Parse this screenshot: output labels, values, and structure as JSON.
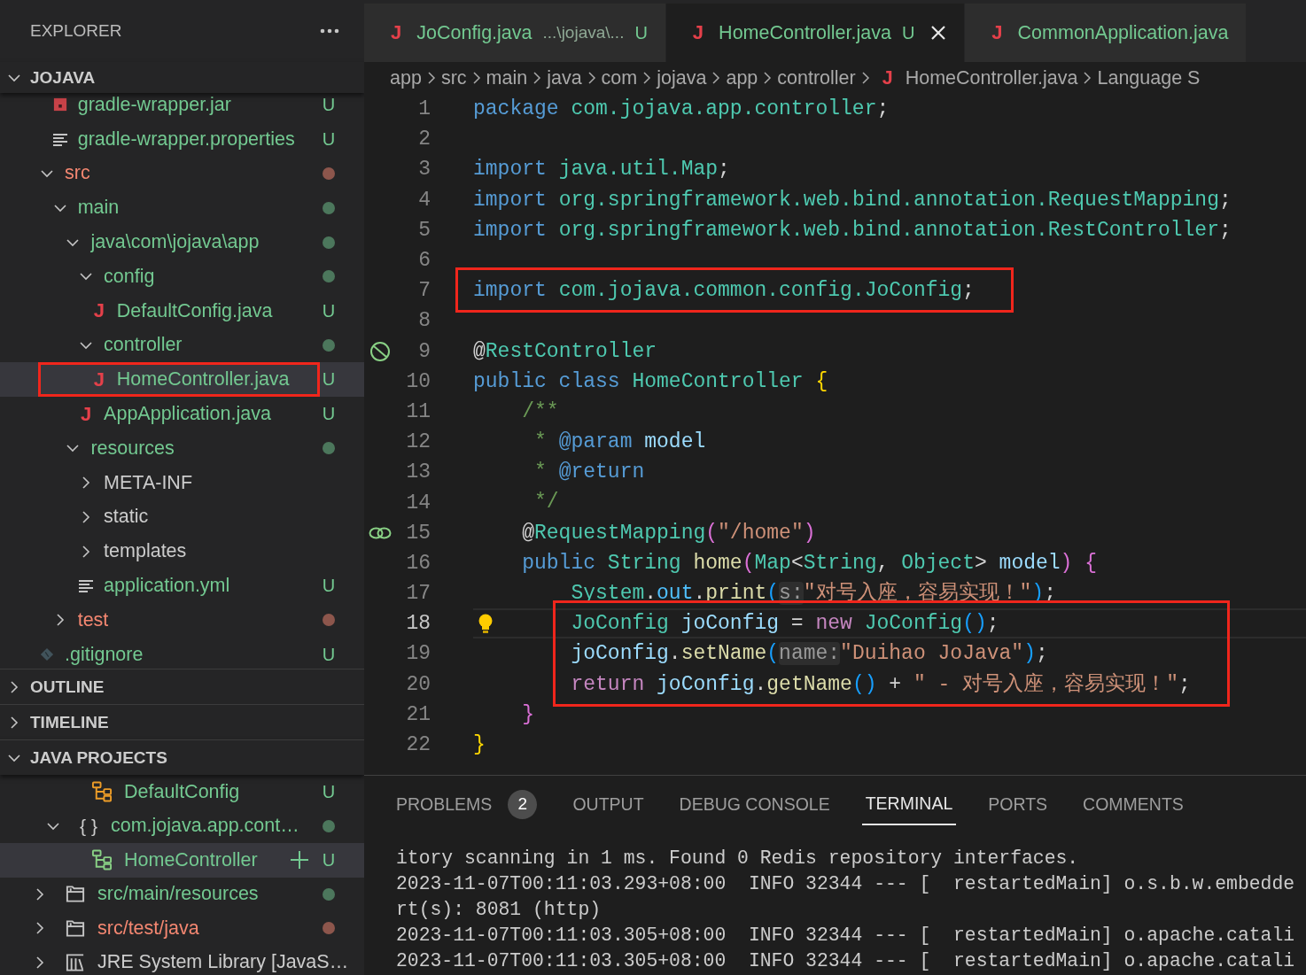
{
  "explorer": {
    "title": "EXPLORER",
    "folder": {
      "label": "JOJAVA",
      "expanded": true
    },
    "tree": [
      {
        "children": [
          {
            "label": "gradle-wrapper.jar",
            "kind": "archive",
            "color": "#73c991",
            "badge": "U",
            "selected": false,
            "highlighted": false
          },
          {
            "label": "gradle-wrapper.properties",
            "kind": "lines",
            "color": "#73c991",
            "badge": "U",
            "selected": false,
            "highlighted": false
          }
        ]
      },
      {
        "label": "src",
        "kind": "folder",
        "expanded": true,
        "color": "#f48771",
        "dot": true,
        "selected": false,
        "highlighted": false,
        "children": [
          {
            "label": "main",
            "kind": "folder",
            "expanded": true,
            "color": "#73c991",
            "dot": true,
            "selected": false,
            "highlighted": false,
            "children": [
              {
                "label": "java\\com\\jojava\\app",
                "kind": "folder",
                "expanded": true,
                "color": "#73c991",
                "dot": true,
                "selected": false,
                "highlighted": false,
                "children": [
                  {
                    "label": "config",
                    "kind": "folder",
                    "expanded": true,
                    "color": "#73c991",
                    "dot": true,
                    "selected": false,
                    "highlighted": false,
                    "children": [
                      {
                        "label": "DefaultConfig.java",
                        "kind": "java",
                        "icon": "J",
                        "color": "#73c991",
                        "badge": "U",
                        "selected": false,
                        "highlighted": false
                      }
                    ]
                  },
                  {
                    "label": "controller",
                    "kind": "folder",
                    "expanded": true,
                    "color": "#73c991",
                    "dot": true,
                    "selected": false,
                    "highlighted": false,
                    "children": [
                      {
                        "label": "HomeController.java",
                        "kind": "java",
                        "icon": "J",
                        "color": "#73c991",
                        "badge": "U",
                        "selected": true,
                        "highlighted": true
                      }
                    ]
                  },
                  {
                    "label": "AppApplication.java",
                    "kind": "java",
                    "icon": "J",
                    "color": "#73c991",
                    "badge": "U",
                    "selected": false,
                    "highlighted": false
                  }
                ]
              },
              {
                "label": "resources",
                "kind": "folder",
                "expanded": true,
                "color": "#73c991",
                "dot": true,
                "selected": false,
                "highlighted": false,
                "children": [
                  {
                    "label": "META-INF",
                    "kind": "folder",
                    "expanded": false,
                    "color": "#cccccc",
                    "selected": false,
                    "highlighted": false
                  },
                  {
                    "label": "static",
                    "kind": "folder",
                    "expanded": false,
                    "color": "#cccccc",
                    "selected": false,
                    "highlighted": false
                  },
                  {
                    "label": "templates",
                    "kind": "folder",
                    "expanded": false,
                    "color": "#cccccc",
                    "selected": false,
                    "highlighted": false
                  },
                  {
                    "label": "application.yml",
                    "kind": "lines",
                    "color": "#73c991",
                    "badge": "U",
                    "selected": false,
                    "highlighted": false
                  }
                ]
              }
            ]
          },
          {
            "label": "test",
            "kind": "folder",
            "expanded": false,
            "color": "#f48771",
            "dot": true,
            "selected": false,
            "highlighted": false
          }
        ]
      },
      {
        "label": ".gitignore",
        "kind": "git",
        "color": "#73c991",
        "badge": "U",
        "selected": false,
        "highlighted": false
      }
    ]
  },
  "sections": [
    {
      "label": "OUTLINE",
      "expanded": false
    },
    {
      "label": "TIMELINE",
      "expanded": false
    }
  ],
  "java_projects": {
    "label": "JAVA PROJECTS",
    "expanded": true,
    "tree": [
      {
        "children": [
          {
            "children": [
              {
                "label": "DefaultConfig",
                "kind": "class",
                "color": "#73c991",
                "badge": "U",
                "selected": false
              }
            ]
          },
          {
            "label": "com.jojava.app.cont…",
            "kind": "package",
            "icon": "{ }",
            "expanded": true,
            "color": "#73c991",
            "dot": true,
            "selected": false,
            "children": [
              {
                "label": "HomeController",
                "kind": "class",
                "color": "#73c991",
                "badge": "U",
                "selected": true
              }
            ]
          }
        ]
      },
      {
        "label": "src/main/resources",
        "kind": "folders",
        "expanded": false,
        "color": "#73c991",
        "dot": true,
        "selected": false
      },
      {
        "label": "src/test/java",
        "kind": "folders",
        "expanded": false,
        "color": "#f48771",
        "dot": true,
        "selected": false
      },
      {
        "label": "JRE System Library [JavaS…",
        "kind": "library",
        "expanded": false,
        "color": "#cccccc",
        "selected": false
      }
    ]
  },
  "tabs": [
    {
      "icon": "J",
      "label": "JoConfig.java",
      "description": "...\\jojava\\...",
      "badge": "U",
      "selected": false
    },
    {
      "icon": "J",
      "label": "HomeController.java",
      "badge": "U",
      "selected": true
    },
    {
      "icon": "J",
      "label": "CommonApplication.java",
      "selected": false
    }
  ],
  "breadcrumb": [
    {
      "label": "app"
    },
    {
      "label": "src"
    },
    {
      "label": "main"
    },
    {
      "label": "java"
    },
    {
      "label": "com"
    },
    {
      "label": "jojava"
    },
    {
      "label": "app"
    },
    {
      "label": "controller"
    },
    {
      "icon": "J",
      "label": "HomeController.java"
    },
    {
      "label": "Language S"
    }
  ],
  "code": [
    {
      "number": "1",
      "current": false,
      "boxed": false,
      "tokens": [
        {
          "text": "package ",
          "kind": "kw"
        },
        {
          "text": "com.jojava.app.controller",
          "kind": "type"
        },
        {
          "text": ";",
          "kind": "plain"
        }
      ]
    },
    {
      "number": "2",
      "current": false,
      "boxed": false
    },
    {
      "number": "3",
      "current": false,
      "boxed": false,
      "tokens": [
        {
          "text": "import ",
          "kind": "kw"
        },
        {
          "text": "java.util.Map",
          "kind": "type"
        },
        {
          "text": ";",
          "kind": "plain"
        }
      ]
    },
    {
      "number": "4",
      "current": false,
      "boxed": false,
      "tokens": [
        {
          "text": "import ",
          "kind": "kw"
        },
        {
          "text": "org.springframework.web.bind.annotation.RequestMapping",
          "kind": "type"
        },
        {
          "text": ";",
          "kind": "plain"
        }
      ]
    },
    {
      "number": "5",
      "current": false,
      "boxed": false,
      "tokens": [
        {
          "text": "import ",
          "kind": "kw"
        },
        {
          "text": "org.springframework.web.bind.annotation.RestController",
          "kind": "type"
        },
        {
          "text": ";",
          "kind": "plain"
        }
      ]
    },
    {
      "number": "6",
      "current": false,
      "boxed": false
    },
    {
      "number": "7",
      "current": false,
      "boxed": true,
      "tokens": [
        {
          "text": "import ",
          "kind": "kw"
        },
        {
          "text": "com.jojava.common.config.JoConfig",
          "kind": "type"
        },
        {
          "text": ";",
          "kind": "plain"
        }
      ]
    },
    {
      "number": "8",
      "current": false,
      "boxed": false
    },
    {
      "number": "9",
      "current": false,
      "boxed": false,
      "tokens": [
        {
          "text": "@",
          "kind": "plain"
        },
        {
          "text": "RestController",
          "kind": "type"
        }
      ]
    },
    {
      "number": "10",
      "current": false,
      "boxed": false,
      "tokens": [
        {
          "text": "public class ",
          "kind": "kw"
        },
        {
          "text": "HomeController ",
          "kind": "type"
        },
        {
          "text": "{",
          "kind": "b1"
        }
      ]
    },
    {
      "number": "11",
      "current": false,
      "boxed": false,
      "tokens": [
        {
          "text": "    /**",
          "kind": "cmt"
        }
      ]
    },
    {
      "number": "12",
      "current": false,
      "boxed": false,
      "tokens": [
        {
          "text": "     * ",
          "kind": "cmt"
        },
        {
          "text": "@param ",
          "kind": "kw"
        },
        {
          "text": "model",
          "kind": "var"
        }
      ]
    },
    {
      "number": "13",
      "current": false,
      "boxed": false,
      "tokens": [
        {
          "text": "     * ",
          "kind": "cmt"
        },
        {
          "text": "@return",
          "kind": "kw"
        }
      ]
    },
    {
      "number": "14",
      "current": false,
      "boxed": false,
      "tokens": [
        {
          "text": "     */",
          "kind": "cmt"
        }
      ]
    },
    {
      "number": "15",
      "current": false,
      "boxed": false,
      "tokens": [
        {
          "text": "    @",
          "kind": "plain"
        },
        {
          "text": "RequestMapping",
          "kind": "type"
        },
        {
          "text": "(",
          "kind": "b2"
        },
        {
          "text": "\"/home\"",
          "kind": "str"
        },
        {
          "text": ")",
          "kind": "b2"
        }
      ]
    },
    {
      "number": "16",
      "current": false,
      "boxed": false,
      "tokens": [
        {
          "text": "    public ",
          "kind": "kw"
        },
        {
          "text": "String ",
          "kind": "type"
        },
        {
          "text": "home",
          "kind": "fn"
        },
        {
          "text": "(",
          "kind": "b2"
        },
        {
          "text": "Map",
          "kind": "type"
        },
        {
          "text": "<",
          "kind": "plain"
        },
        {
          "text": "String",
          "kind": "type"
        },
        {
          "text": ", ",
          "kind": "plain"
        },
        {
          "text": "Object",
          "kind": "type"
        },
        {
          "text": "> ",
          "kind": "plain"
        },
        {
          "text": "model",
          "kind": "var"
        },
        {
          "text": ") {",
          "kind": "b2"
        }
      ]
    },
    {
      "number": "17",
      "current": false,
      "boxed": false,
      "tokens": [
        {
          "text": "        System",
          "kind": "type"
        },
        {
          "text": ".",
          "kind": "plain"
        },
        {
          "text": "out",
          "kind": "field"
        },
        {
          "text": ".",
          "kind": "plain"
        },
        {
          "text": "print",
          "kind": "fn"
        },
        {
          "text": "(",
          "kind": "b3"
        },
        {
          "text": "s:",
          "kind": "hint"
        },
        {
          "text": "\"对号入座，容易实现！\"",
          "kind": "str"
        },
        {
          "text": ")",
          "kind": "b3"
        },
        {
          "text": ";",
          "kind": "plain"
        }
      ]
    },
    {
      "number": "18",
      "current": true,
      "boxed": true,
      "tokens": [
        {
          "text": "        JoConfig ",
          "kind": "type"
        },
        {
          "text": "joConfig",
          "kind": "var"
        },
        {
          "text": " = ",
          "kind": "plain"
        },
        {
          "text": "new ",
          "kind": "ctrl"
        },
        {
          "text": "JoConfig",
          "kind": "type"
        },
        {
          "text": "()",
          "kind": "b3"
        },
        {
          "text": ";",
          "kind": "plain"
        }
      ]
    },
    {
      "number": "19",
      "current": false,
      "boxed": true,
      "tokens": [
        {
          "text": "        joConfig",
          "kind": "var"
        },
        {
          "text": ".",
          "kind": "plain"
        },
        {
          "text": "setName",
          "kind": "fn"
        },
        {
          "text": "(",
          "kind": "b3"
        },
        {
          "text": "name:",
          "kind": "hint"
        },
        {
          "text": "\"Duihao JoJava\"",
          "kind": "str"
        },
        {
          "text": ")",
          "kind": "b3"
        },
        {
          "text": ";",
          "kind": "plain"
        }
      ]
    },
    {
      "number": "20",
      "current": false,
      "boxed": true,
      "tokens": [
        {
          "text": "        return ",
          "kind": "ctrl"
        },
        {
          "text": "joConfig",
          "kind": "var"
        },
        {
          "text": ".",
          "kind": "plain"
        },
        {
          "text": "getName",
          "kind": "fn"
        },
        {
          "text": "()",
          "kind": "b3"
        },
        {
          "text": " + ",
          "kind": "plain"
        },
        {
          "text": "\" - 对号入座，容易实现！\"",
          "kind": "str"
        },
        {
          "text": ";",
          "kind": "plain"
        }
      ]
    },
    {
      "number": "21",
      "current": false,
      "boxed": false,
      "tokens": [
        {
          "text": "    }",
          "kind": "b2"
        }
      ]
    },
    {
      "number": "22",
      "current": false,
      "boxed": false,
      "tokens": [
        {
          "text": "}",
          "kind": "b1"
        }
      ]
    }
  ],
  "panel": {
    "tabs": [
      {
        "label": "PROBLEMS",
        "badge": "2",
        "selected": false
      },
      {
        "label": "OUTPUT",
        "selected": false
      },
      {
        "label": "DEBUG CONSOLE",
        "selected": false
      },
      {
        "label": "TERMINAL",
        "selected": true
      },
      {
        "label": "PORTS",
        "selected": false
      },
      {
        "label": "COMMENTS",
        "selected": false
      }
    ],
    "terminal": [
      "itory scanning in 1 ms. Found 0 Redis repository interfaces.",
      "2023-11-07T00:11:03.293+08:00  INFO 32344 --- [  restartedMain] o.s.b.w.embedde",
      "rt(s): 8081 (http)",
      "2023-11-07T00:11:03.305+08:00  INFO 32344 --- [  restartedMain] o.apache.catali",
      "2023-11-07T00:11:03.305+08:00  INFO 32344 --- [  restartedMain] o.apache.catali"
    ]
  }
}
